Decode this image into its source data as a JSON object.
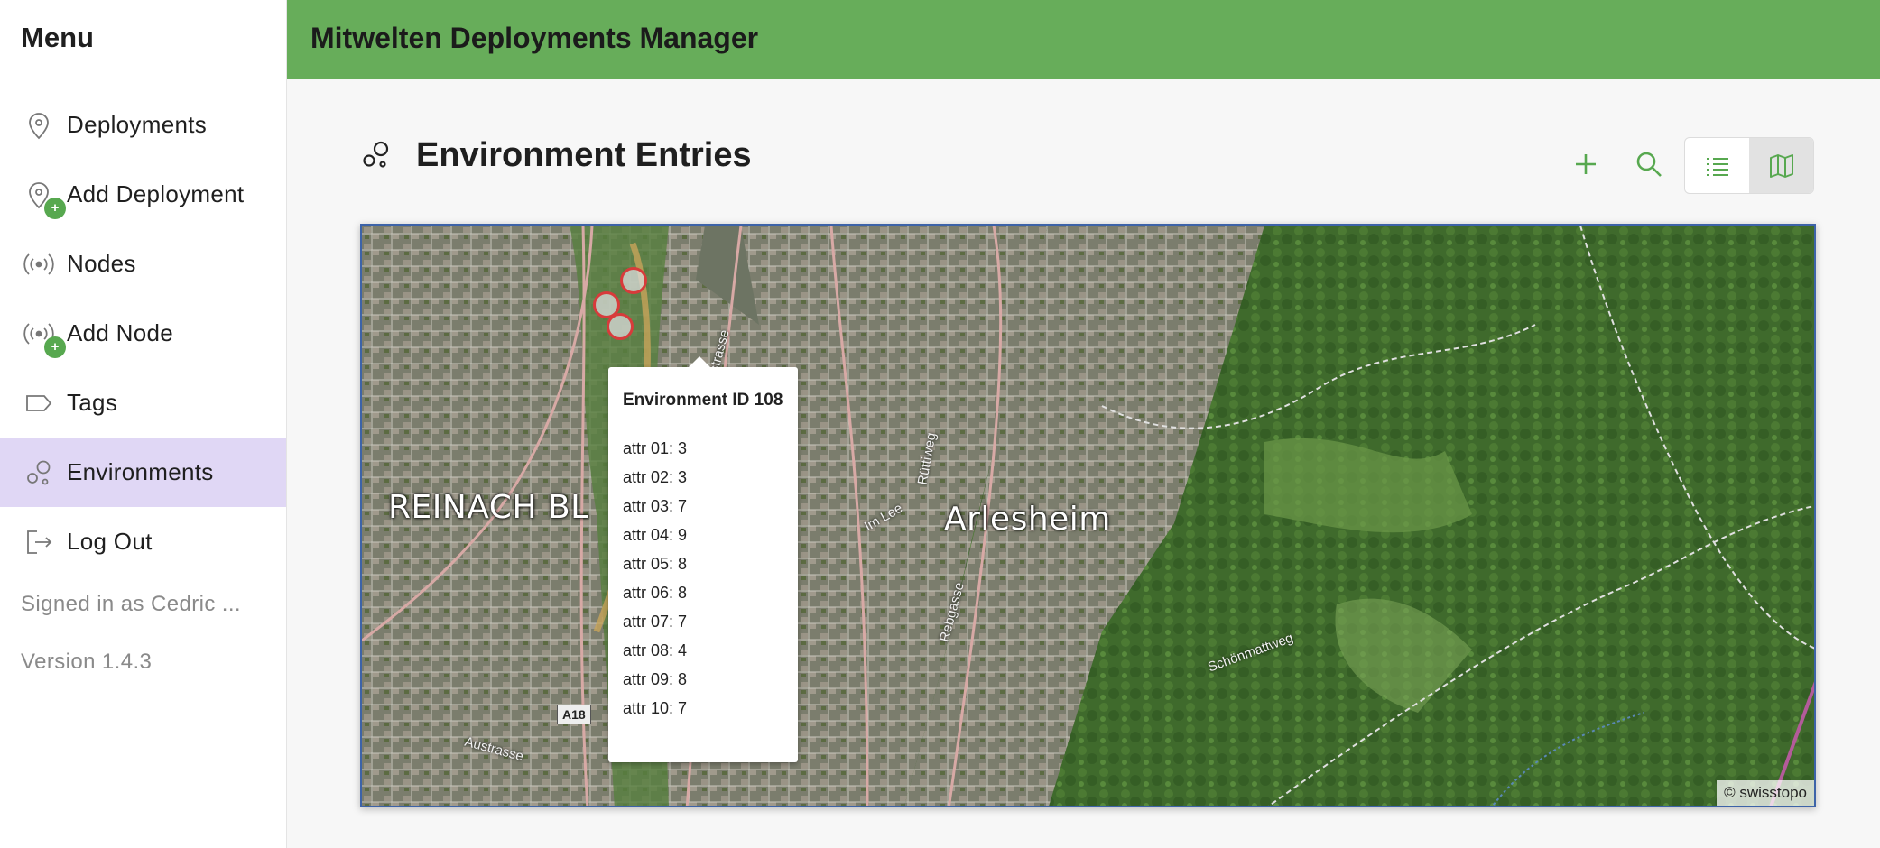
{
  "sidebar": {
    "title": "Menu",
    "items": [
      {
        "label": "Deployments",
        "icon": "map-pin-icon"
      },
      {
        "label": "Add Deployment",
        "icon": "map-pin-add-icon"
      },
      {
        "label": "Nodes",
        "icon": "broadcast-icon"
      },
      {
        "label": "Add Node",
        "icon": "broadcast-add-icon"
      },
      {
        "label": "Tags",
        "icon": "tag-icon"
      },
      {
        "label": "Environments",
        "icon": "bubbles-icon",
        "active": true
      },
      {
        "label": "Log Out",
        "icon": "logout-icon"
      }
    ],
    "badge": "+",
    "signed_in": "Signed in as Cedric ...",
    "version": "Version 1.4.3"
  },
  "header": {
    "title": "Mitwelten Deployments Manager",
    "color": "#67ad5a"
  },
  "page": {
    "title": "Environment Entries",
    "icon": "bubbles-icon",
    "actions": [
      "add-icon",
      "search-icon"
    ],
    "view_modes": [
      {
        "name": "list-view-icon",
        "selected": false
      },
      {
        "name": "map-view-icon",
        "selected": true
      }
    ]
  },
  "map": {
    "place_labels": [
      "REINACH BL",
      "Arlesheim"
    ],
    "street_labels": [
      "Talstrasse",
      "Im Lee",
      "Rüttiweg",
      "Rebgasse",
      "Schönmattweg",
      "Austrasse"
    ],
    "route_badge": "A18",
    "attribution": "© swisstopo",
    "marker_color": "#d83b3b",
    "popup": {
      "title": "Environment ID 108",
      "attrs": [
        "attr 01: 3",
        "attr 02: 3",
        "attr 03: 7",
        "attr 04: 9",
        "attr 05: 8",
        "attr 06: 8",
        "attr 07: 7",
        "attr 08: 4",
        "attr 09: 8",
        "attr 10: 7"
      ]
    }
  }
}
